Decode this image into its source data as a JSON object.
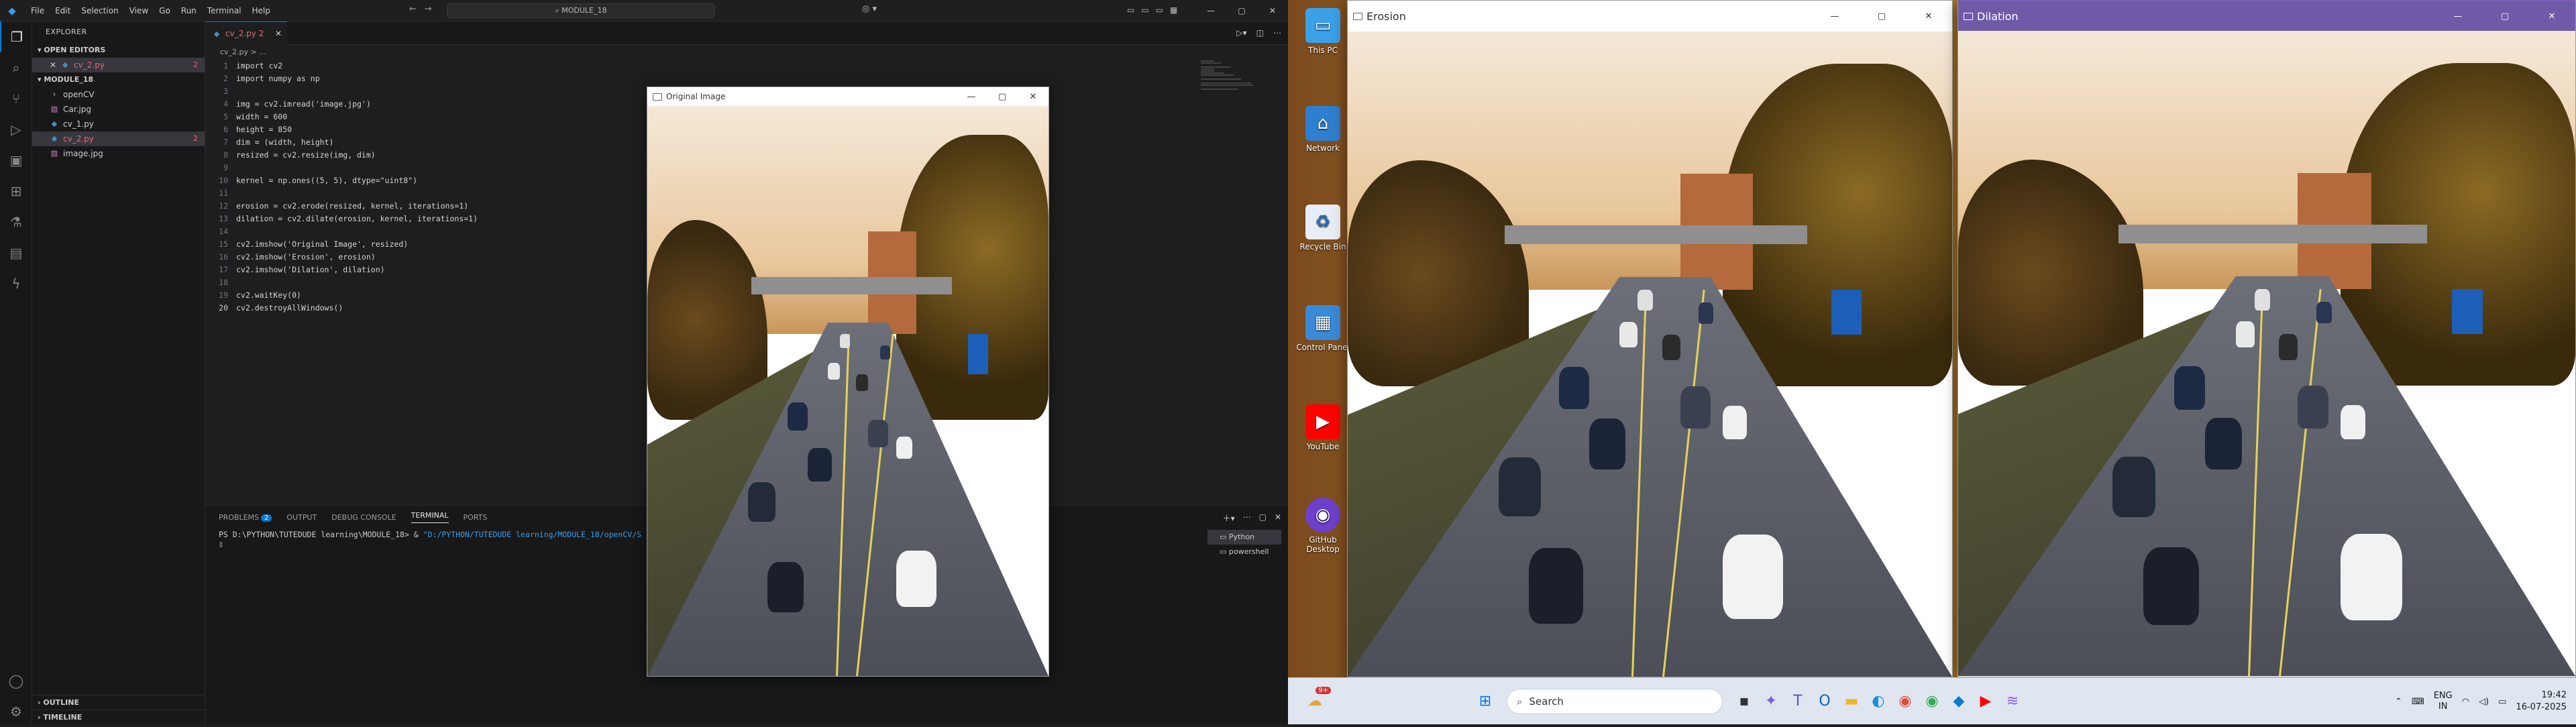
{
  "vscode": {
    "menu": [
      "File",
      "Edit",
      "Selection",
      "View",
      "Go",
      "Run",
      "Terminal",
      "Help"
    ],
    "command_center": "MODULE_18",
    "explorer_title": "EXPLORER",
    "open_editors_label": "OPEN EDITORS",
    "open_editor_file": "cv_2.py",
    "open_editor_badge": "2",
    "folder_label": "MODULE_18",
    "files": [
      {
        "name": "openCV",
        "type": "folder",
        "badge": ""
      },
      {
        "name": "Car.jpg",
        "type": "image",
        "badge": ""
      },
      {
        "name": "cv_1.py",
        "type": "python",
        "badge": ""
      },
      {
        "name": "cv_2.py",
        "type": "python",
        "badge": "2"
      },
      {
        "name": "image.jpg",
        "type": "image",
        "badge": ""
      }
    ],
    "outline_label": "OUTLINE",
    "timeline_label": "TIMELINE",
    "tab_label": "cv_2.py",
    "tab_badge": "2",
    "breadcrumb": "cv_2.py > ...",
    "code": [
      "import cv2",
      "import numpy as np",
      "",
      "img = cv2.imread('image.jpg')",
      "width = 600",
      "height = 850",
      "dim = (width, height)",
      "resized = cv2.resize(img, dim)",
      "",
      "kernel = np.ones((5, 5), dtype=\"uint8\")",
      "",
      "erosion = cv2.erode(resized, kernel, iterations=1)",
      "dilation = cv2.dilate(erosion, kernel, iterations=1)",
      "",
      "cv2.imshow('Original Image', resized)",
      "cv2.imshow('Erosion', erosion)",
      "cv2.imshow('Dilation', dilation)",
      "",
      "cv2.waitKey(0)",
      "cv2.destroyAllWindows()"
    ],
    "panel_tabs": [
      "PROBLEMS",
      "OUTPUT",
      "DEBUG CONSOLE",
      "TERMINAL",
      "PORTS"
    ],
    "problems_count": "2",
    "terminal_prompt": "PS D:\\PYTHON\\TUTEDUDE learning\\MODULE_18> & ",
    "terminal_command": "\"D:/PYTHON/TUTEDUDE learning/MODULE_18/openCV/S",
    "terminal_list": [
      "Python",
      "powershell"
    ]
  },
  "windows": {
    "original_title": "Original Image",
    "erosion_title": "Erosion",
    "dilation_title": "Dilation"
  },
  "desktop_icons": [
    {
      "label": "This PC",
      "icon": "monitor-icon"
    },
    {
      "label": "Network",
      "icon": "network-icon"
    },
    {
      "label": "Recycle Bin",
      "icon": "recycle-bin-icon"
    },
    {
      "label": "Control Panel",
      "icon": "control-panel-icon"
    },
    {
      "label": "YouTube",
      "icon": "youtube-icon"
    },
    {
      "label": "GitHub Desktop",
      "icon": "github-icon"
    }
  ],
  "taskbar": {
    "search_placeholder": "Search",
    "weather_badge": "9+",
    "language": "ENG",
    "region": "IN",
    "time": "19:42",
    "date": "16-07-2025"
  },
  "colors": {
    "accent": "#0078d4",
    "error": "#e06c75"
  }
}
